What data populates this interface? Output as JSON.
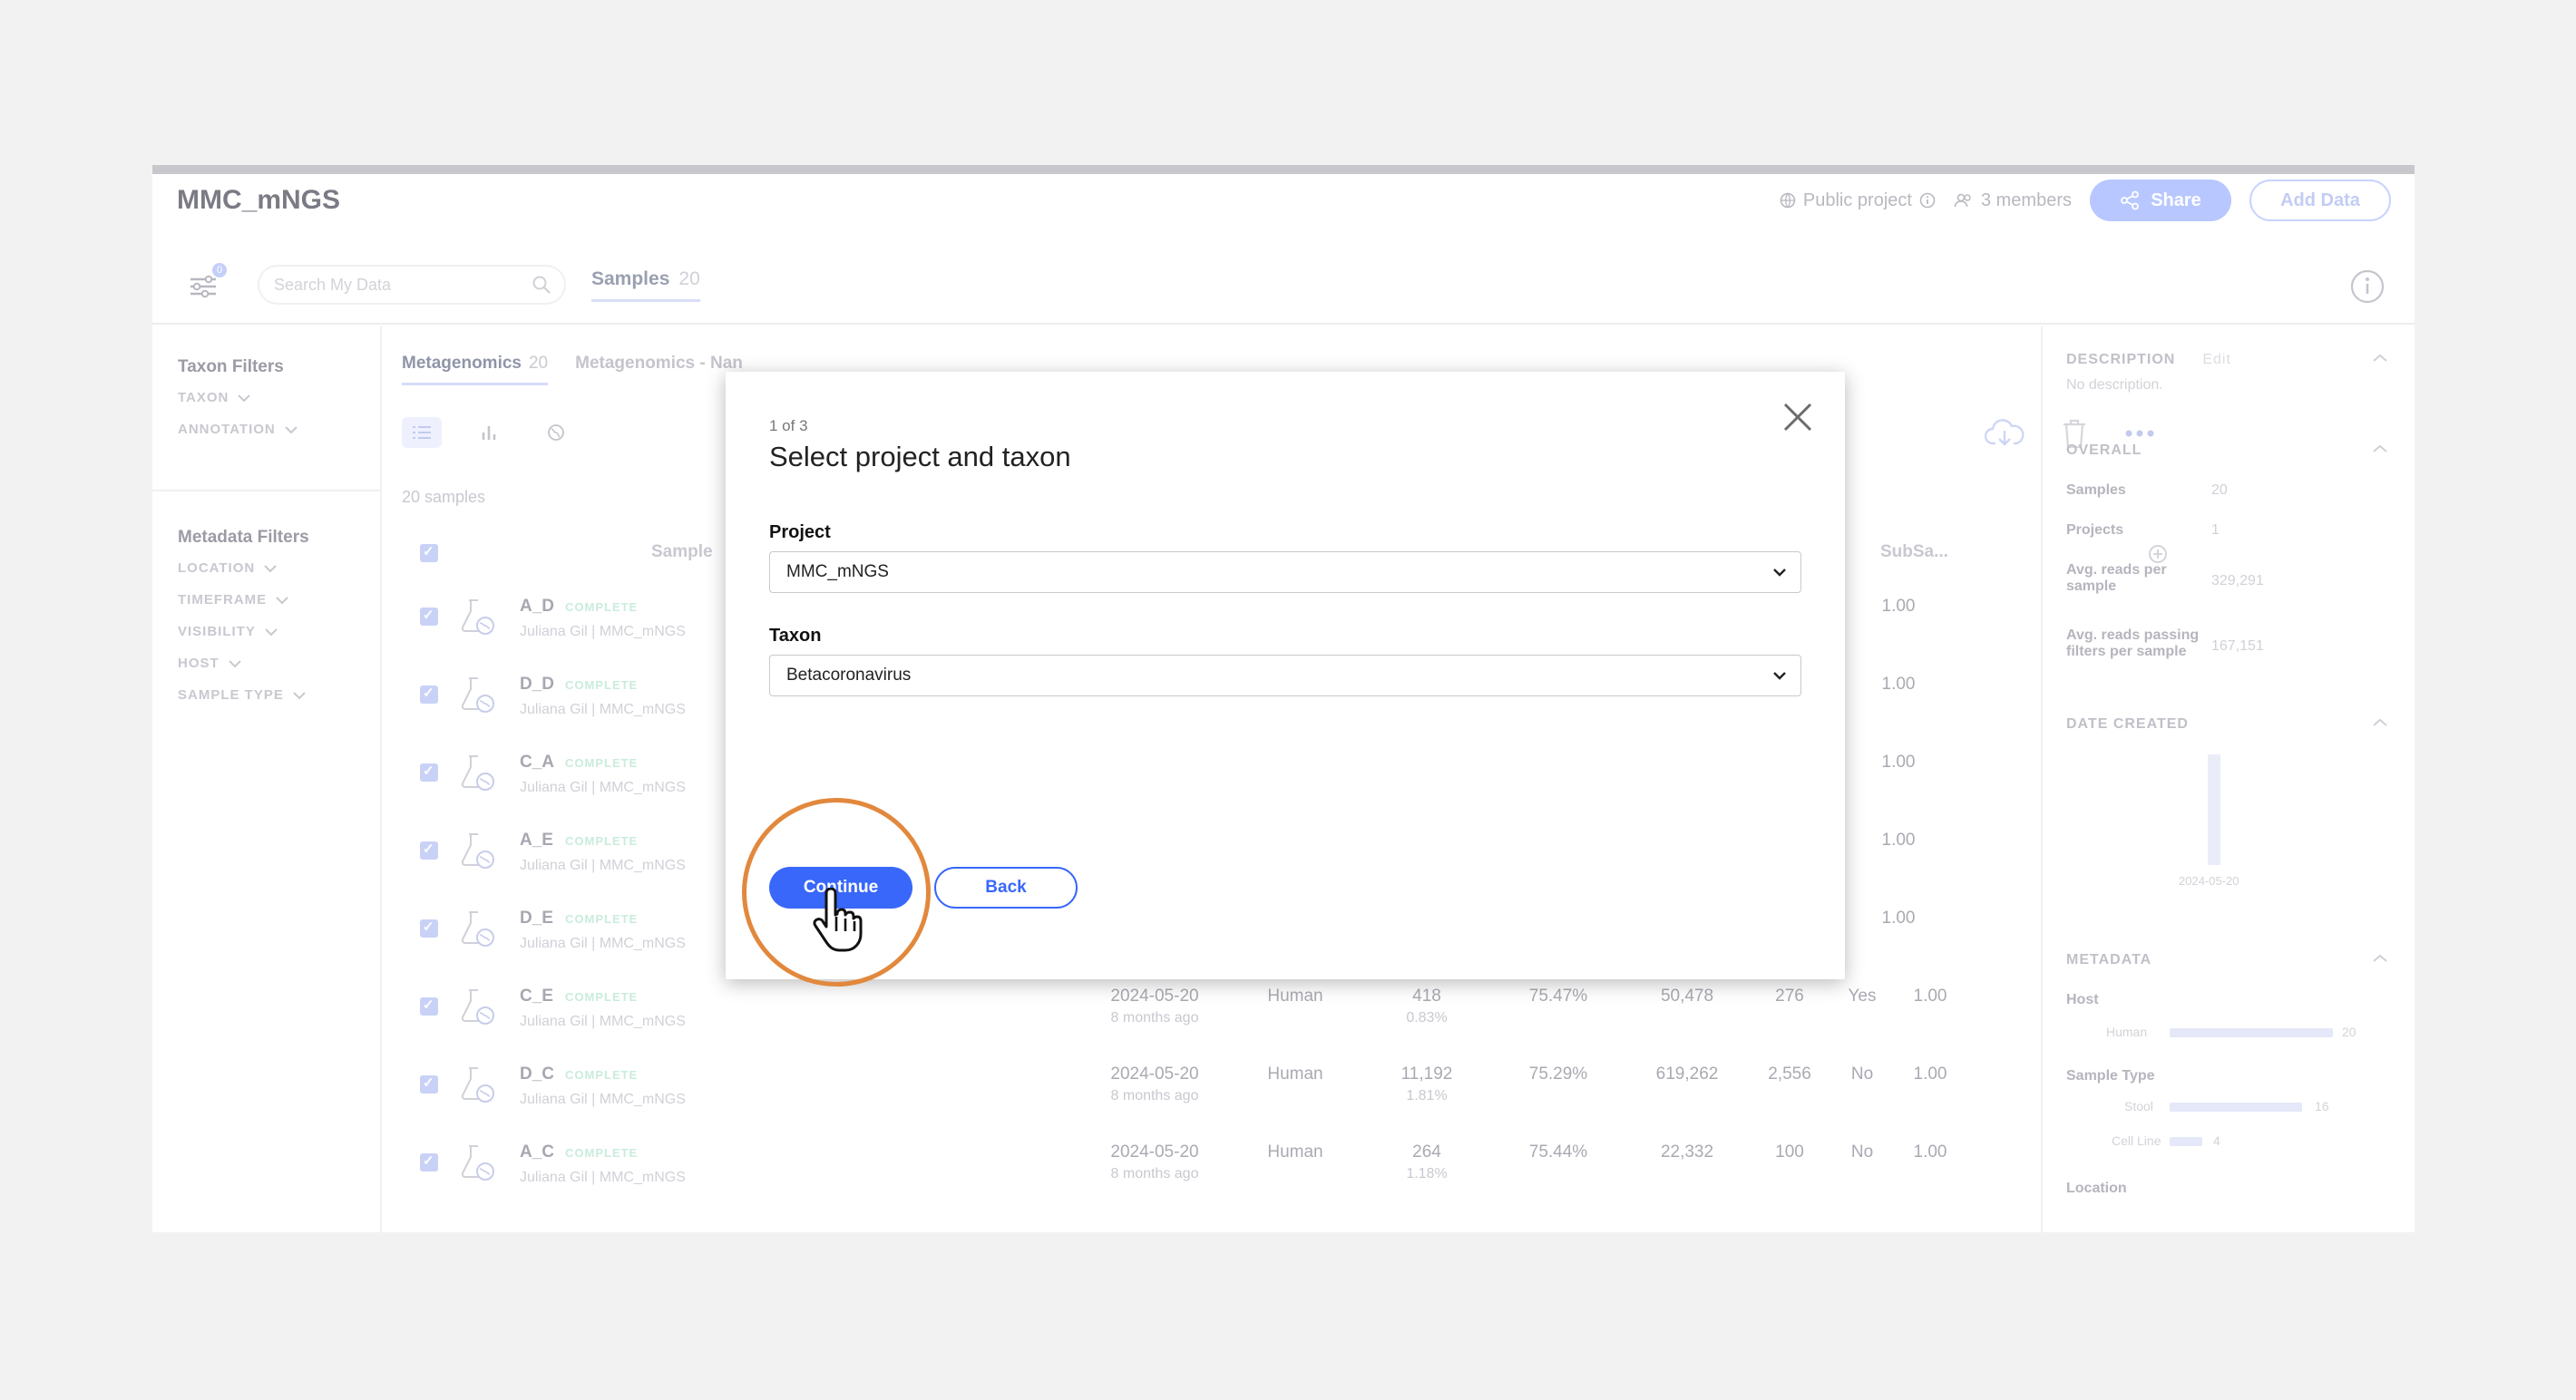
{
  "app": {
    "title": "MMC_mNGS",
    "header": {
      "public_label": "Public project",
      "members_label": "3 members",
      "share_label": "Share",
      "add_data_label": "Add Data"
    },
    "toolbar": {
      "filter_count": "0",
      "search_placeholder": "Search My Data",
      "samples_tab_label": "Samples",
      "samples_tab_count": "20"
    }
  },
  "left_filters": {
    "taxon_heading": "Taxon Filters",
    "taxon_items": [
      "TAXON",
      "ANNOTATION"
    ],
    "metadata_heading": "Metadata Filters",
    "metadata_items": [
      "LOCATION",
      "TIMEFRAME",
      "VISIBILITY",
      "HOST",
      "SAMPLE TYPE"
    ]
  },
  "table": {
    "subtabs": [
      {
        "label": "Metagenomics",
        "count": "20"
      },
      {
        "label": "Metagenomics - Nan"
      }
    ],
    "samples_count": "20 samples",
    "columns": {
      "sample": "Sample",
      "subsampled": "SubSa..."
    },
    "rows": [
      {
        "name": "A_D",
        "status": "COMPLETE",
        "user": "Juliana Gil  |  MMC_mNGS",
        "subsampled": "1.00"
      },
      {
        "name": "D_D",
        "status": "COMPLETE",
        "user": "Juliana Gil  |  MMC_mNGS",
        "subsampled": "1.00"
      },
      {
        "name": "C_A",
        "status": "COMPLETE",
        "user": "Juliana Gil  |  MMC_mNGS",
        "subsampled": "1.00"
      },
      {
        "name": "A_E",
        "status": "COMPLETE",
        "user": "Juliana Gil  |  MMC_mNGS",
        "subsampled": "1.00"
      },
      {
        "name": "D_E",
        "status": "COMPLETE",
        "user": "Juliana Gil  |  MMC_mNGS",
        "subsampled": "1.00"
      },
      {
        "name": "C_E",
        "status": "COMPLETE",
        "user": "Juliana Gil  |  MMC_mNGS",
        "date": "2024-05-20",
        "ago": "8 months ago",
        "host": "Human",
        "reads": "418",
        "reads_pct": "0.83%",
        "pct": "75.47%",
        "total": "50,478",
        "dup": "276",
        "flag": "Yes",
        "subsampled": "1.00"
      },
      {
        "name": "D_C",
        "status": "COMPLETE",
        "user": "Juliana Gil  |  MMC_mNGS",
        "date": "2024-05-20",
        "ago": "8 months ago",
        "host": "Human",
        "reads": "11,192",
        "reads_pct": "1.81%",
        "pct": "75.29%",
        "total": "619,262",
        "dup": "2,556",
        "flag": "No",
        "subsampled": "1.00"
      },
      {
        "name": "A_C",
        "status": "COMPLETE",
        "user": "Juliana Gil  |  MMC_mNGS",
        "date": "2024-05-20",
        "ago": "8 months ago",
        "host": "Human",
        "reads": "264",
        "reads_pct": "1.18%",
        "pct": "75.44%",
        "total": "22,332",
        "dup": "100",
        "flag": "No",
        "subsampled": "1.00"
      }
    ]
  },
  "right_panel": {
    "description_heading": "DESCRIPTION",
    "description_edit": "Edit",
    "description_text": "No description.",
    "overall_heading": "OVERALL",
    "overall": [
      {
        "label": "Samples",
        "value": "20"
      },
      {
        "label": "Projects",
        "value": "1"
      },
      {
        "label": "Avg. reads per sample",
        "value": "329,291"
      },
      {
        "label": "Avg. reads passing filters per sample",
        "value": "167,151"
      }
    ],
    "date_heading": "DATE CREATED",
    "date_label": "2024-05-20",
    "metadata_heading": "METADATA",
    "host_label": "Host",
    "host_rows": [
      {
        "label": "Human",
        "value": "20"
      }
    ],
    "sample_type_label": "Sample Type",
    "sample_type_rows": [
      {
        "label": "Stool",
        "value": "16"
      },
      {
        "label": "Cell Line",
        "value": "4"
      }
    ],
    "location_label": "Location"
  },
  "modal": {
    "step": "1 of 3",
    "title": "Select project and taxon",
    "project_label": "Project",
    "project_value": "MMC_mNGS",
    "taxon_label": "Taxon",
    "taxon_value": "Betacoronavirus",
    "continue_label": "Continue",
    "back_label": "Back"
  },
  "colors": {
    "accent": "#3867fa",
    "highlight": "#e2883d"
  }
}
